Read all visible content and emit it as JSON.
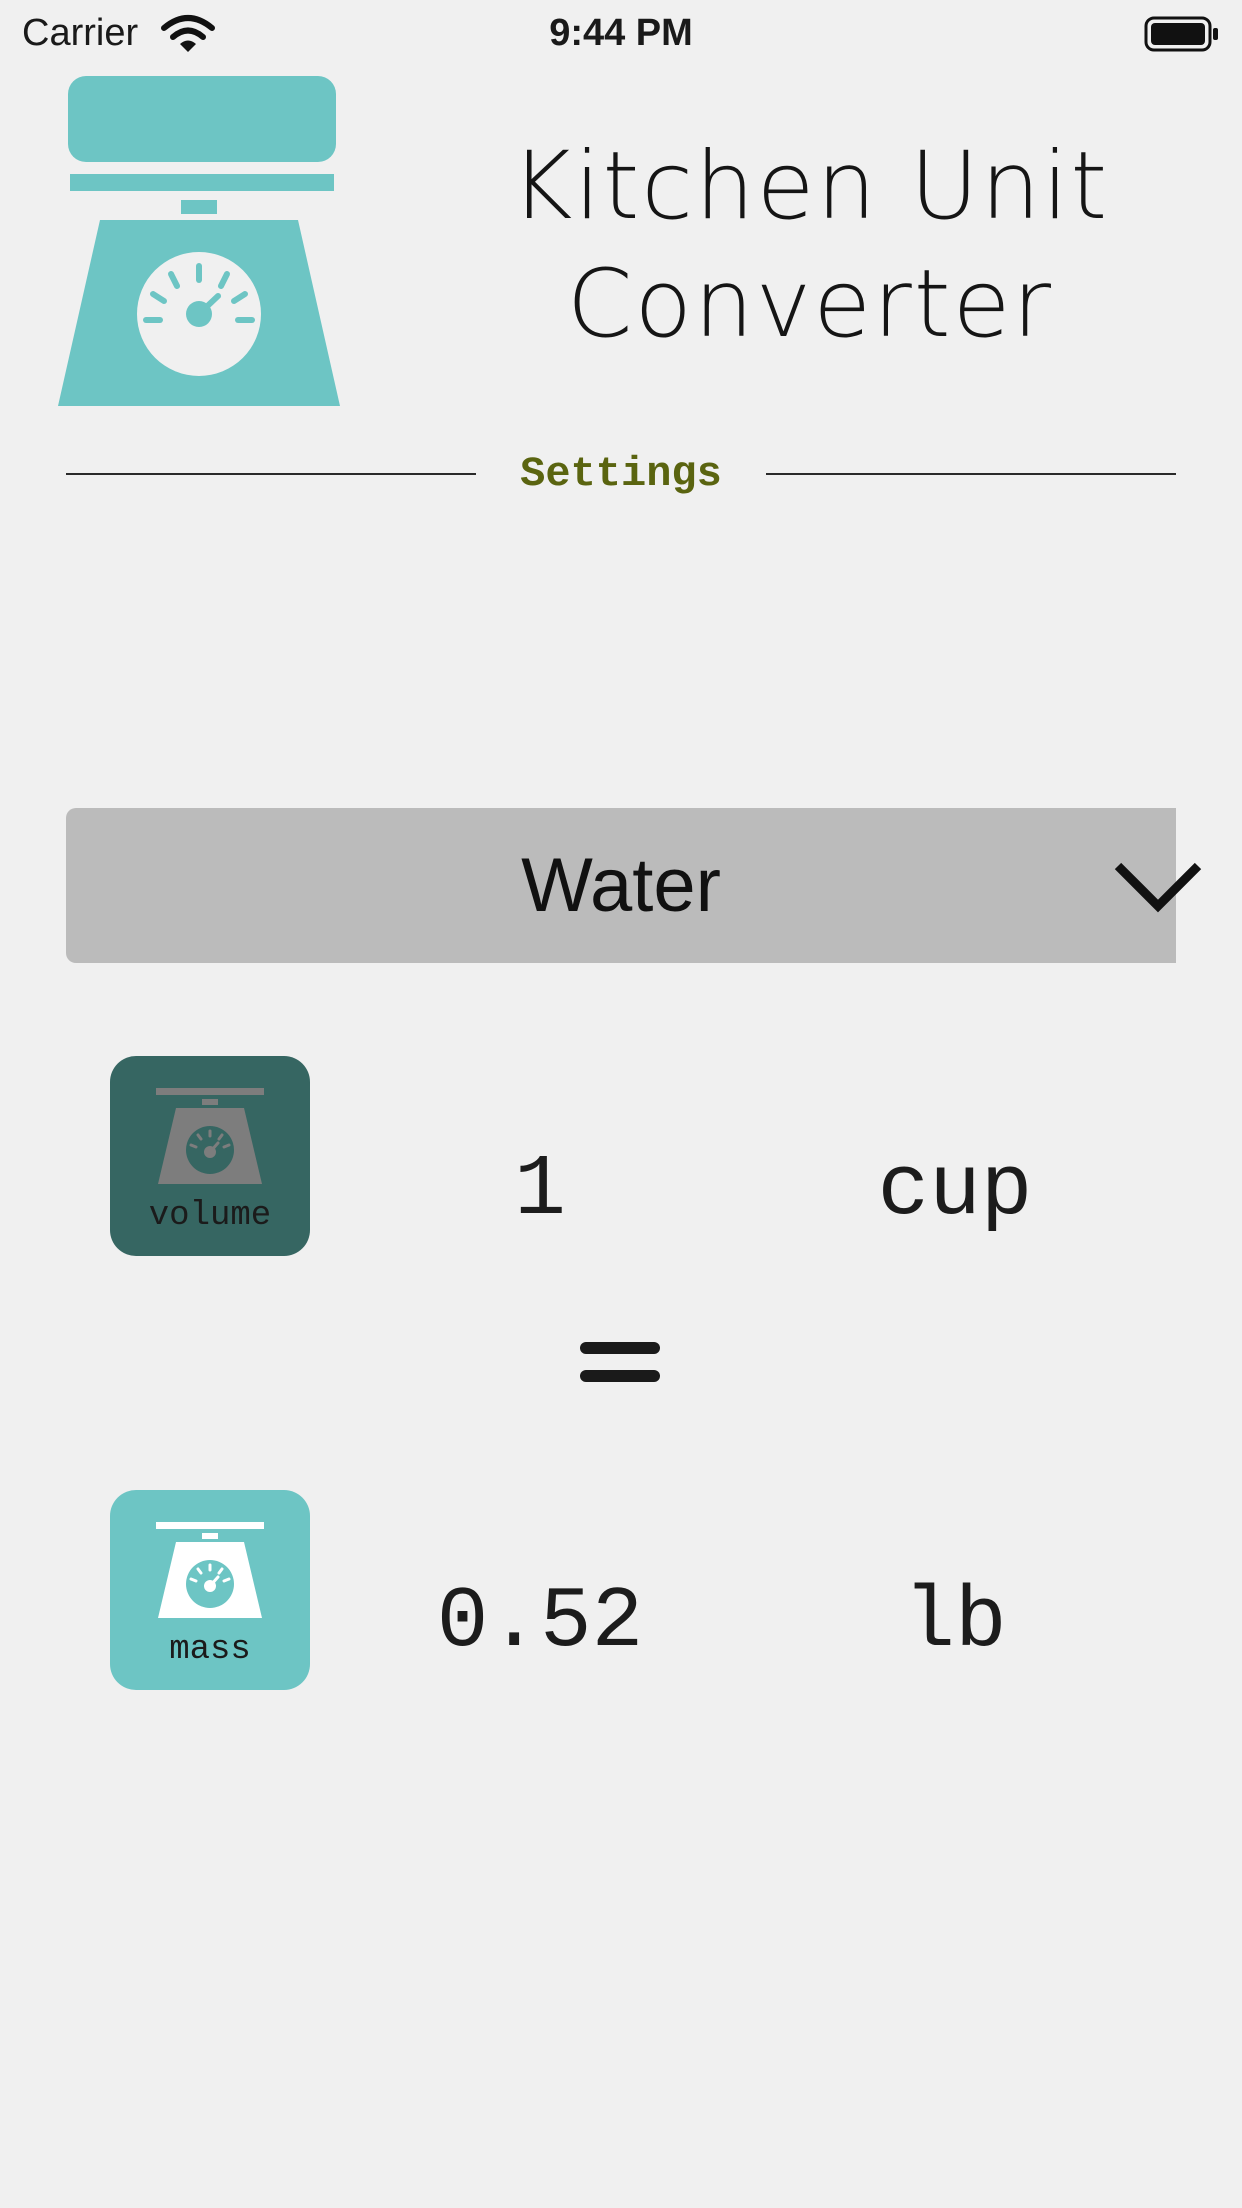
{
  "status_bar": {
    "carrier": "Carrier",
    "time": "9:44 PM"
  },
  "app": {
    "title_line1": "Kitchen Unit",
    "title_line2": "Converter",
    "settings_label": "Settings"
  },
  "ingredient": {
    "selected": "Water"
  },
  "input_row": {
    "type_label": "volume",
    "value": "1",
    "unit": "cup"
  },
  "output_row": {
    "type_label": "mass",
    "value": "0.52",
    "unit": "lb"
  },
  "colors": {
    "accent_teal": "#6dc5c4",
    "dark_teal": "#366662",
    "settings_text": "#5a6410",
    "background": "#f0f0f0",
    "dropdown_bg": "#bbbbbb"
  },
  "icons": {
    "logo": "kitchen-scale-icon",
    "wifi": "wifi-icon",
    "battery": "battery-icon",
    "dropdown": "chevron-down-icon",
    "equals": "equals-icon"
  }
}
